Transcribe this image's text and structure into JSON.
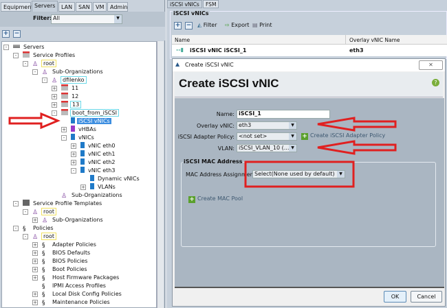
{
  "left_tabs": [
    "Equipment",
    "Servers",
    "LAN",
    "SAN",
    "VM",
    "Admin"
  ],
  "active_left_tab": "Servers",
  "filter": {
    "label": "Filter:",
    "value": "All"
  },
  "tree": [
    {
      "label": "Servers",
      "level": 0,
      "toggle": "-",
      "icon": "server-icon"
    },
    {
      "label": "Service Profiles",
      "level": 1,
      "toggle": "-",
      "icon": "service-profile-icon"
    },
    {
      "label": "root",
      "level": 2,
      "toggle": "-",
      "icon": "org-icon",
      "box": "y"
    },
    {
      "label": "Sub-Organizations",
      "level": 3,
      "toggle": "-",
      "icon": "org-icon"
    },
    {
      "label": "dfilenko",
      "level": 4,
      "toggle": "-",
      "icon": "org-icon",
      "box": "c"
    },
    {
      "label": "11",
      "level": 5,
      "toggle": "+",
      "icon": "service-profile-icon"
    },
    {
      "label": "12",
      "level": 5,
      "toggle": "+",
      "icon": "service-profile-icon"
    },
    {
      "label": "13",
      "level": 5,
      "toggle": "+",
      "icon": "service-profile-icon",
      "box": "c"
    },
    {
      "label": "boot_from_iSCSI",
      "level": 5,
      "toggle": "-",
      "icon": "service-profile-icon",
      "box": "c"
    },
    {
      "label": "iSCSI vNICs",
      "level": 6,
      "toggle": "",
      "icon": "vnic-icon",
      "selected": true
    },
    {
      "label": "vHBAs",
      "level": 6,
      "toggle": "+",
      "icon": "vhba-icon"
    },
    {
      "label": "vNICs",
      "level": 6,
      "toggle": "-",
      "icon": "vnic-icon"
    },
    {
      "label": "vNIC eth0",
      "level": 7,
      "toggle": "+",
      "icon": "vnic-icon"
    },
    {
      "label": "vNIC eth1",
      "level": 7,
      "toggle": "+",
      "icon": "vnic-icon"
    },
    {
      "label": "vNIC eth2",
      "level": 7,
      "toggle": "+",
      "icon": "vnic-icon"
    },
    {
      "label": "vNIC eth3",
      "level": 7,
      "toggle": "-",
      "icon": "vnic-icon"
    },
    {
      "label": "Dynamic vNICs",
      "level": 8,
      "toggle": "",
      "icon": "vnic-icon"
    },
    {
      "label": "VLANs",
      "level": 8,
      "toggle": "+",
      "icon": "vnic-icon"
    },
    {
      "label": "Sub-Organizations",
      "level": 5,
      "toggle": "",
      "icon": "org-icon"
    },
    {
      "label": "Service Profile Templates",
      "level": 1,
      "toggle": "-",
      "icon": "template-icon"
    },
    {
      "label": "root",
      "level": 2,
      "toggle": "-",
      "icon": "org-icon",
      "box": "y"
    },
    {
      "label": "Sub-Organizations",
      "level": 3,
      "toggle": "+",
      "icon": "org-icon"
    },
    {
      "label": "Policies",
      "level": 1,
      "toggle": "-",
      "icon": "policy-icon"
    },
    {
      "label": "root",
      "level": 2,
      "toggle": "-",
      "icon": "org-icon",
      "box": "y"
    },
    {
      "label": "Adapter Policies",
      "level": 3,
      "toggle": "+",
      "icon": "policy-icon"
    },
    {
      "label": "BIOS Defaults",
      "level": 3,
      "toggle": "+",
      "icon": "policy-icon"
    },
    {
      "label": "BIOS Policies",
      "level": 3,
      "toggle": "+",
      "icon": "policy-icon"
    },
    {
      "label": "Boot Policies",
      "level": 3,
      "toggle": "+",
      "icon": "policy-icon"
    },
    {
      "label": "Host Firmware Packages",
      "level": 3,
      "toggle": "+",
      "icon": "policy-icon"
    },
    {
      "label": "IPMI Access Profiles",
      "level": 3,
      "toggle": "",
      "icon": "policy-icon"
    },
    {
      "label": "Local Disk Config Policies",
      "level": 3,
      "toggle": "+",
      "icon": "policy-icon"
    },
    {
      "label": "Maintenance Policies",
      "level": 3,
      "toggle": "+",
      "icon": "policy-icon"
    }
  ],
  "right": {
    "tabs": [
      "iSCSI vNICs",
      "FSM"
    ],
    "group_title": "iSCSI vNICs",
    "toolbar": {
      "filter": "Filter",
      "export": "Export",
      "print": "Print"
    },
    "columns": [
      "Name",
      "Overlay vNIC Name"
    ],
    "rows": [
      {
        "name": "iSCSI vNIC iSCSI_1",
        "overlay": "eth3"
      }
    ]
  },
  "dialog": {
    "window_title": "Create iSCSI vNIC",
    "heading": "Create iSCSI vNIC",
    "name_label": "Name:",
    "name_value": "iSCSI_1",
    "overlay_label": "Overlay vNIC:",
    "overlay_value": "eth3",
    "adapter_label": "iSCSI Adapter Policy:",
    "adapter_value": "<not set>",
    "create_adapter": "Create iSCSI Adapter Policy",
    "vlan_label": "VLAN:",
    "vlan_value": "iSCSI_VLAN_10 (...",
    "mac_group": "iSCSI MAC Address",
    "mac_label": "MAC Address Assignment:",
    "mac_value": "Select(None used by default)",
    "create_mac_pool": "Create MAC Pool",
    "ok": "OK",
    "cancel": "Cancel"
  },
  "colors": {
    "annotation_red": "#e02020",
    "selection": "#3d8ee0"
  }
}
